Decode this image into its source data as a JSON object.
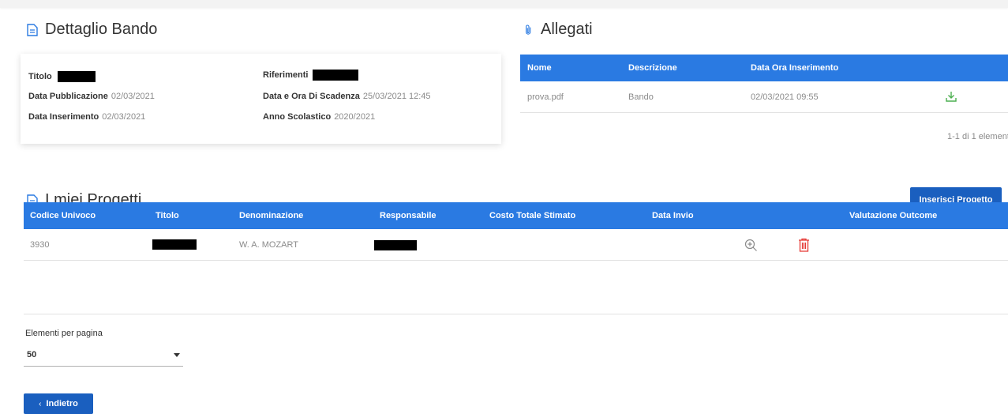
{
  "dettaglio": {
    "title": "Dettaglio Bando",
    "titolo_label": "Titolo",
    "riferimenti_label": "Riferimenti",
    "data_pubblicazione_label": "Data Pubblicazione",
    "data_pubblicazione_value": "02/03/2021",
    "data_scadenza_label": "Data e Ora Di Scadenza",
    "data_scadenza_value": "25/03/2021 12:45",
    "data_inserimento_label": "Data Inserimento",
    "data_inserimento_value": "02/03/2021",
    "anno_scolastico_label": "Anno Scolastico",
    "anno_scolastico_value": "2020/2021"
  },
  "allegati": {
    "title": "Allegati",
    "headers": [
      "Nome",
      "Descrizione",
      "Data Ora Inserimento"
    ],
    "rows": [
      {
        "nome": "prova.pdf",
        "descrizione": "Bando",
        "data": "02/03/2021 09:55"
      }
    ],
    "pager": "1-1 di 1 element"
  },
  "progetti": {
    "title": "I miei Progetti",
    "insert_button": "Inserisci Progetto",
    "headers": [
      "Codice Univoco",
      "Titolo",
      "Denominazione",
      "Responsabile",
      "Costo Totale Stimato",
      "Data Invio",
      "Valutazione Outcome"
    ],
    "rows": [
      {
        "codice": "3930",
        "denominazione": "W. A. MOZART"
      }
    ]
  },
  "pagination": {
    "label": "Elementi per pagina",
    "value": "50"
  },
  "back_button": "Indietro",
  "colors": {
    "primary": "#2a7ae2",
    "button": "#1a5fbf",
    "download": "#4caf50",
    "delete": "#e53935"
  }
}
